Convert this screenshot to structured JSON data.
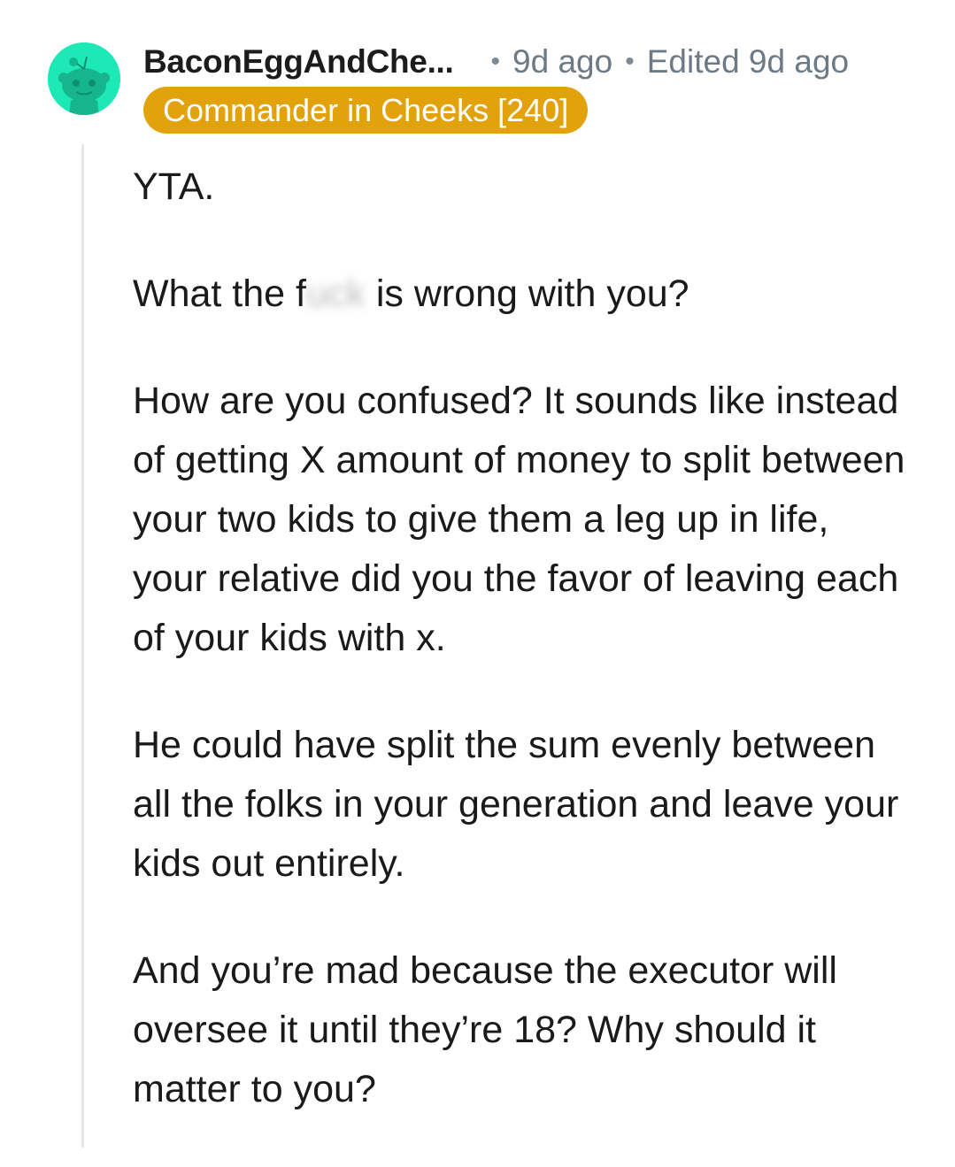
{
  "comment": {
    "username": "BaconEggAndChe...",
    "age": "9d ago",
    "edited": "Edited 9d ago",
    "flair": "Commander in Cheeks [240]",
    "paragraphs": {
      "p1": "YTA.",
      "p2_before": "What the f",
      "p2_censored": "uck",
      "p2_after": " is wrong with you?",
      "p3": "How are you confused? It sounds like instead of getting X amount of money to split between your two kids to give them a leg up in life, your relative did you the favor of leaving each of your kids with x.",
      "p4": "He could have split the sum evenly between all the folks in your generation and leave your kids out entirely.",
      "p5": "And you’re mad because the executor will oversee it until they’re 18? Why should it matter to you?"
    }
  },
  "colors": {
    "avatar_bg": "#1de9b6",
    "flair_bg": "#e2a20b",
    "meta_text": "#6b7a86"
  },
  "icons": {
    "avatar": "snoo-avatar-icon",
    "separator": "bullet-dot"
  }
}
